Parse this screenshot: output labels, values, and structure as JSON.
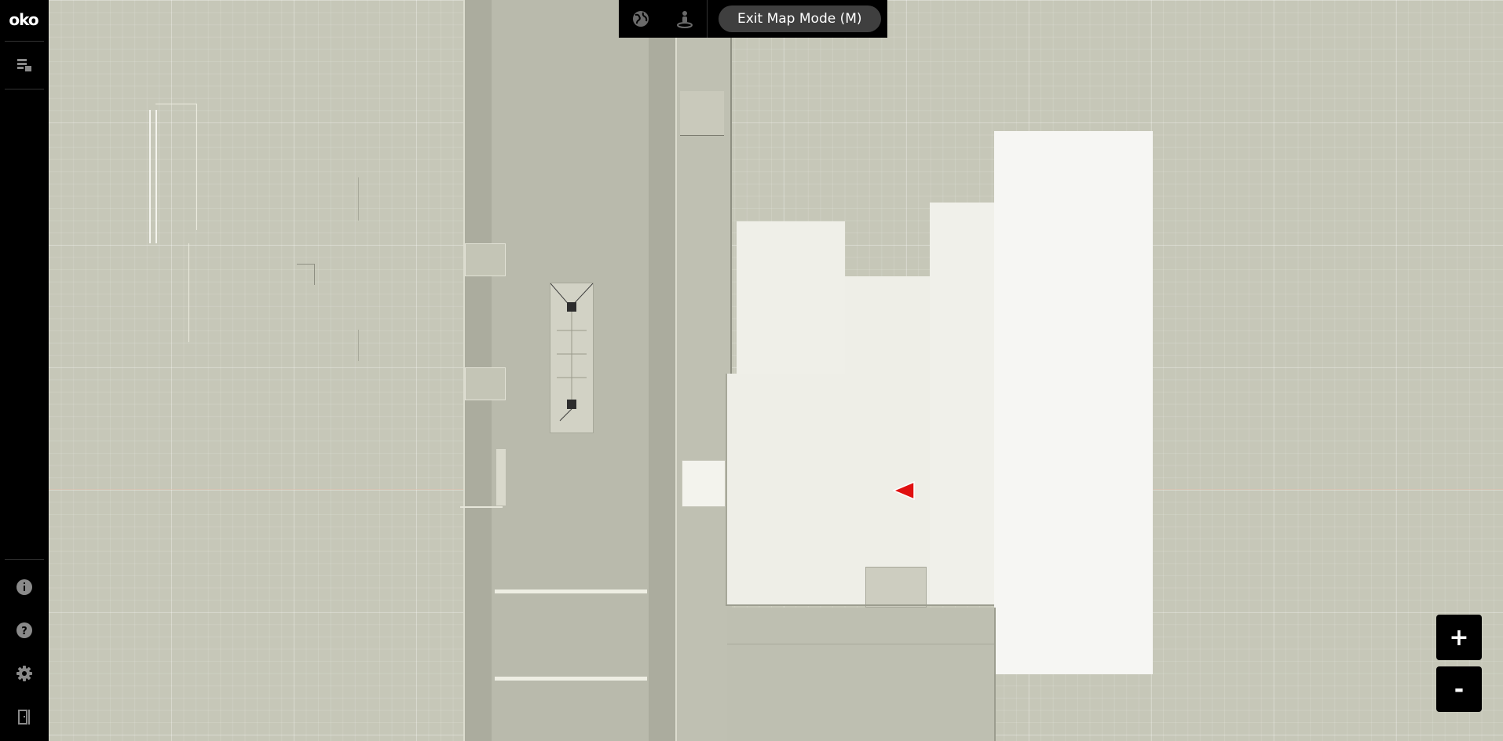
{
  "app": {
    "logo_text": "oko"
  },
  "sidebar": {
    "top_items": [
      {
        "icon": "layers-icon"
      }
    ],
    "bottom_items": [
      {
        "icon": "info-icon"
      },
      {
        "icon": "help-icon"
      },
      {
        "icon": "gear-icon"
      },
      {
        "icon": "exit-door-icon"
      }
    ]
  },
  "toolbar": {
    "globe_icon": "globe-icon",
    "pin_icon": "person-pin-icon",
    "exit_label": "Exit Map Mode (M)"
  },
  "zoom": {
    "in_label": "+",
    "out_label": "-"
  },
  "colors": {
    "sidebar_bg": "#000000",
    "map_ground": "#c6c7b8",
    "road": "#b3b4a6",
    "building": "#f1f1ea",
    "marker": "#e01010"
  }
}
